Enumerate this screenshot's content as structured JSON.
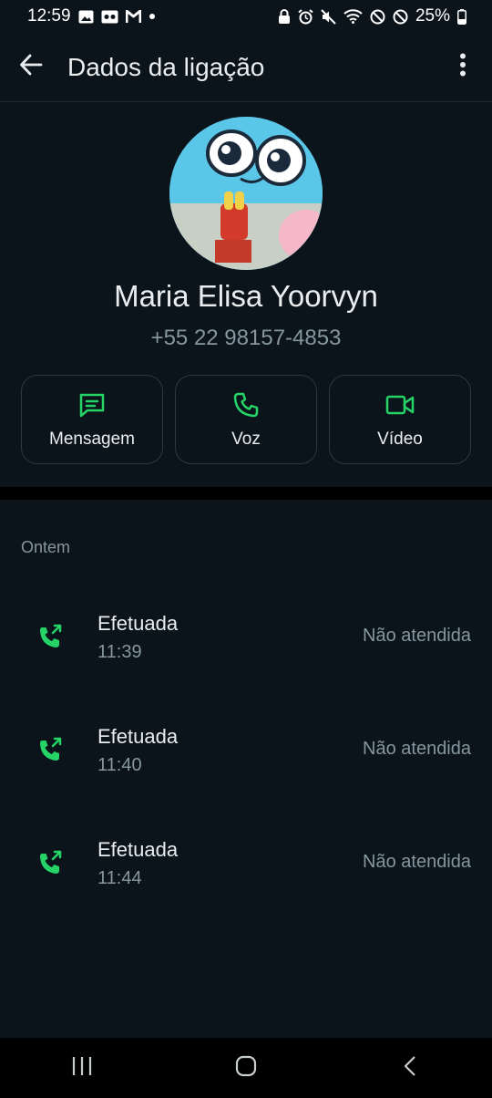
{
  "status_bar": {
    "time": "12:59",
    "battery": "25%",
    "left_icons": [
      "gallery-icon",
      "voicemail-icon",
      "gmail-icon",
      "dot-icon"
    ],
    "right_icons": [
      "lock-icon",
      "alarm-icon",
      "mute-icon",
      "wifi-icon",
      "dnd-icon",
      "dnd-icon",
      "battery-icon"
    ]
  },
  "app_bar": {
    "title": "Dados da ligação",
    "back_icon": "arrow-back-icon",
    "menu_icon": "more-vertical-icon"
  },
  "contact": {
    "name": "Maria Elisa Yoorvyn",
    "phone": "+55 22 98157-4853"
  },
  "actions": [
    {
      "label": "Mensagem",
      "icon": "message-icon"
    },
    {
      "label": "Voz",
      "icon": "phone-icon"
    },
    {
      "label": "Vídeo",
      "icon": "video-icon"
    }
  ],
  "calls": {
    "section_label": "Ontem",
    "items": [
      {
        "type": "Efetuada",
        "time": "11:39",
        "status": "Não atendida",
        "icon": "outgoing-call-icon"
      },
      {
        "type": "Efetuada",
        "time": "11:40",
        "status": "Não atendida",
        "icon": "outgoing-call-icon"
      },
      {
        "type": "Efetuada",
        "time": "11:44",
        "status": "Não atendida",
        "icon": "outgoing-call-icon"
      }
    ]
  },
  "colors": {
    "background": "#0b141a",
    "accent": "#25d366",
    "secondary_text": "#8696a0"
  },
  "nav": {
    "icons": [
      "recent-apps-icon",
      "home-icon",
      "back-icon"
    ]
  }
}
